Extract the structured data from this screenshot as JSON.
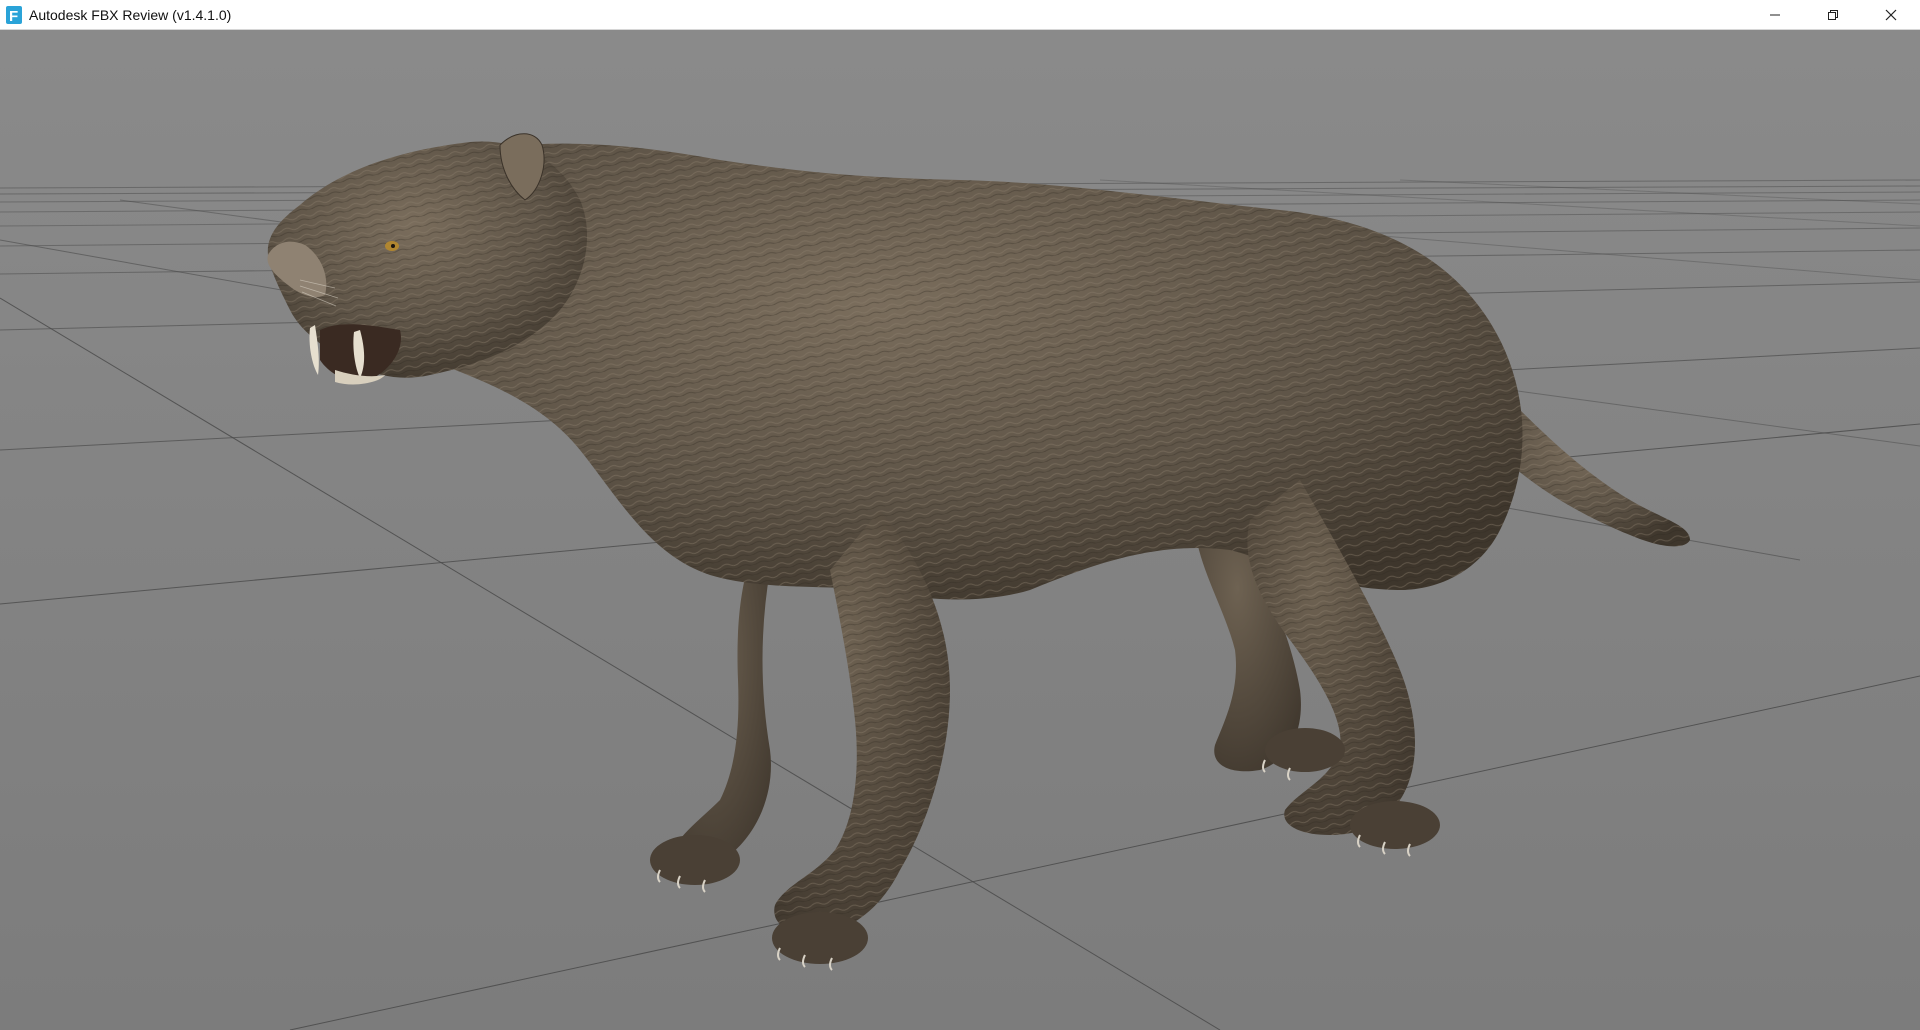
{
  "window": {
    "title": "Autodesk FBX Review (v1.4.1.0)",
    "app_icon_letter": "F",
    "accent_color": "#2aa3d8"
  },
  "controls": {
    "minimize_icon": "minimize-icon",
    "restore_icon": "restore-icon",
    "close_icon": "close-icon"
  },
  "viewport": {
    "background_color": "#808080",
    "grid_color": "#4a4a4a",
    "model_description_icon": "saber-tooth-cat-model",
    "fur_color": "#5e5447"
  }
}
